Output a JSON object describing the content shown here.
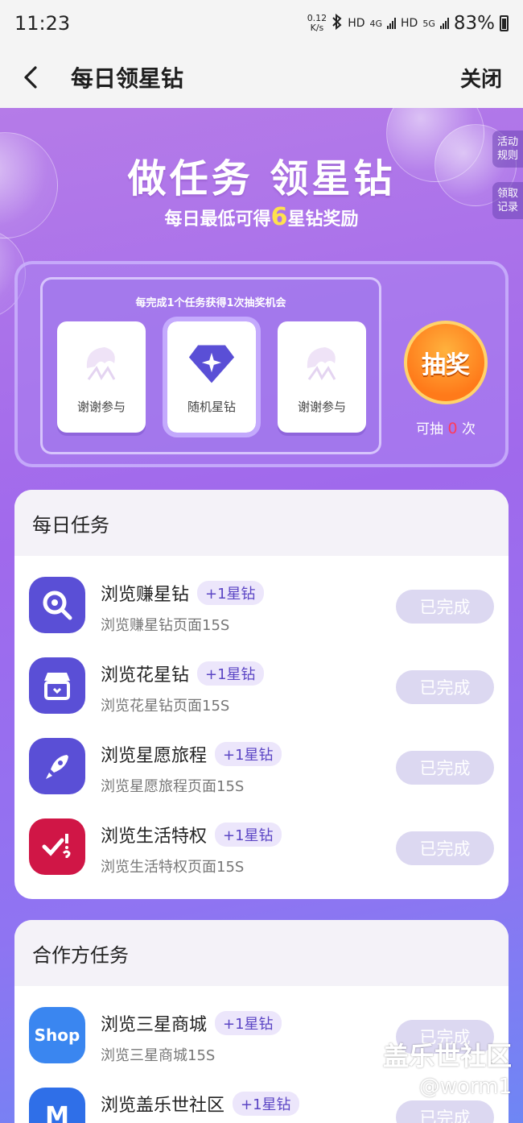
{
  "status": {
    "time": "11:23",
    "speed_value": "0.12",
    "speed_unit": "K/s",
    "hd1": "HD",
    "net1": "4G",
    "hd2": "HD",
    "net2": "5G",
    "battery": "83%"
  },
  "nav": {
    "title": "每日领星钻",
    "close": "关闭"
  },
  "hero": {
    "title": "做任务 领星钻",
    "sub_prefix": "每日最低可得",
    "sub_num": "6",
    "sub_suffix": "星钻奖励",
    "side_rules": "活动\n规则",
    "side_records": "领取\n记录"
  },
  "lottery": {
    "caption": "每完成1个任务获得1次抽奖机会",
    "prizes": [
      {
        "label": "谢谢参与",
        "icon": "thanks-shell-icon"
      },
      {
        "label": "随机星钻",
        "icon": "star-diamond-icon"
      },
      {
        "label": "谢谢参与",
        "icon": "thanks-shell-icon"
      }
    ],
    "draw_button": "抽奖",
    "chance_prefix": "可抽",
    "chance_count": "0",
    "chance_suffix": "次"
  },
  "daily": {
    "title": "每日任务",
    "tasks": [
      {
        "name": "浏览赚星钻",
        "tag": "+1星钻",
        "desc": "浏览赚星钻页面15S",
        "status": "已完成",
        "icon": "search-earn-icon",
        "color": "#5a4fd6"
      },
      {
        "name": "浏览花星钻",
        "tag": "+1星钻",
        "desc": "浏览花星钻页面15S",
        "status": "已完成",
        "icon": "store-icon",
        "color": "#5a4fd6"
      },
      {
        "name": "浏览星愿旅程",
        "tag": "+1星钻",
        "desc": "浏览星愿旅程页面15S",
        "status": "已完成",
        "icon": "rocket-icon",
        "color": "#5a4fd6"
      },
      {
        "name": "浏览生活特权",
        "tag": "+1星钻",
        "desc": "浏览生活特权页面15S",
        "status": "已完成",
        "icon": "check-question-icon",
        "color": "#d01646"
      }
    ]
  },
  "partner": {
    "title": "合作方任务",
    "tasks": [
      {
        "name": "浏览三星商城",
        "tag": "+1星钻",
        "desc": "浏览三星商城15S",
        "status": "已完成",
        "icon_text": "Shop",
        "color": "#3a86f0"
      },
      {
        "name": "浏览盖乐世社区",
        "tag": "+1星钻",
        "desc": "",
        "status": "已完成",
        "icon_text": "M",
        "color": "#2f6fe8"
      }
    ]
  },
  "watermark": {
    "line1": "盖乐世社区",
    "line2": "@worm1"
  }
}
